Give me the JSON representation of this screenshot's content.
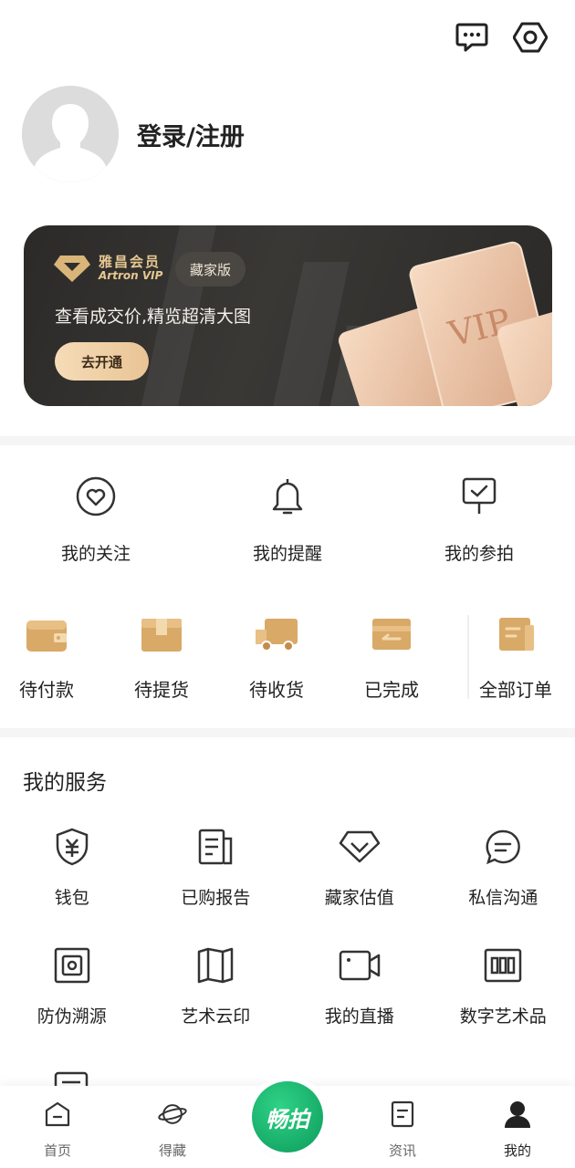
{
  "header": {
    "icons": [
      "message-icon",
      "settings-icon"
    ]
  },
  "profile": {
    "login_label": "登录/注册"
  },
  "vip_card": {
    "brand_cn": "雅昌会员",
    "brand_en": "Artron VIP",
    "tag": "藏家版",
    "desc": "查看成交价,精览超清大图",
    "button": "去开通",
    "art_text": "VIP"
  },
  "quick_links": [
    {
      "label": "我的关注",
      "icon": "heart-icon"
    },
    {
      "label": "我的提醒",
      "icon": "bell-icon"
    },
    {
      "label": "我的参拍",
      "icon": "auction-sign-icon"
    }
  ],
  "orders": [
    {
      "label": "待付款",
      "icon": "wallet-icon"
    },
    {
      "label": "待提货",
      "icon": "package-icon"
    },
    {
      "label": "待收货",
      "icon": "truck-icon"
    },
    {
      "label": "已完成",
      "icon": "card-done-icon"
    },
    {
      "label": "全部订单",
      "icon": "orders-doc-icon"
    }
  ],
  "services": {
    "title": "我的服务",
    "items": [
      {
        "label": "钱包",
        "icon": "wallet-shield-icon"
      },
      {
        "label": "已购报告",
        "icon": "report-icon"
      },
      {
        "label": "藏家估值",
        "icon": "diamond-icon"
      },
      {
        "label": "私信沟通",
        "icon": "chat-icon"
      },
      {
        "label": "防伪溯源",
        "icon": "anti-fake-icon"
      },
      {
        "label": "艺术云印",
        "icon": "book-open-icon"
      },
      {
        "label": "我的直播",
        "icon": "video-icon"
      },
      {
        "label": "数字艺术品",
        "icon": "digital-art-icon"
      }
    ]
  },
  "tabbar": {
    "tabs": [
      {
        "label": "首页",
        "icon": "home-icon"
      },
      {
        "label": "得藏",
        "icon": "planet-icon"
      },
      {
        "label": "资讯",
        "icon": "news-icon"
      },
      {
        "label": "我的",
        "icon": "user-icon"
      }
    ],
    "center_label": "畅拍"
  },
  "colors": {
    "accent_green": "#11a865",
    "gold": "#d9a968",
    "vip_bg": "#2f2e2c"
  }
}
